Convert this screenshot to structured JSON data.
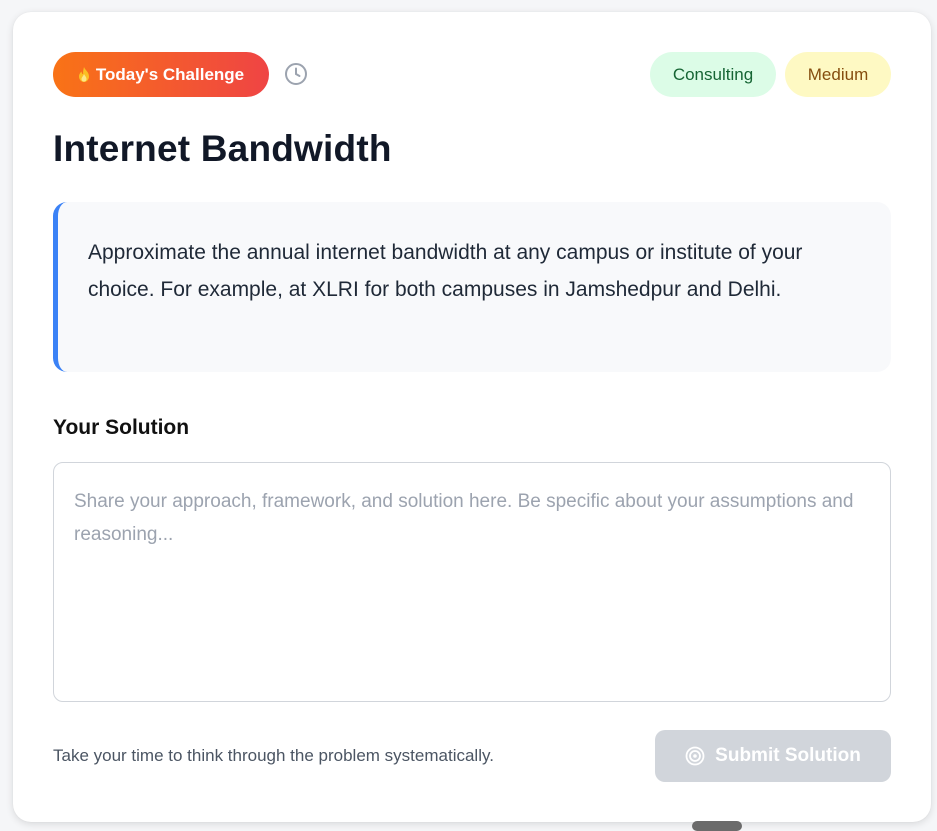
{
  "header": {
    "challenge_badge_label": "Today's Challenge",
    "category_tag": "Consulting",
    "difficulty_tag": "Medium"
  },
  "problem": {
    "title": "Internet Bandwidth",
    "description": "Approximate the annual internet bandwidth at any campus or institute of your choice. For example, at XLRI for both campuses in Jamshedpur and Delhi."
  },
  "solution": {
    "label": "Your Solution",
    "placeholder": "Share your approach, framework, and solution here. Be specific about your assumptions and reasoning...",
    "value": ""
  },
  "footer": {
    "hint": "Take your time to think through the problem systematically.",
    "submit_label": "Submit Solution"
  },
  "icons": {
    "badge": "fire-icon",
    "timer": "clock-icon",
    "submit": "target-icon"
  },
  "colors": {
    "badge_gradient_start": "#f97316",
    "badge_gradient_end": "#ef4444",
    "accent_border": "#3b82f6",
    "consulting_bg": "#dcfce7",
    "consulting_text": "#166534",
    "medium_bg": "#fef9c3",
    "medium_text": "#854d0e",
    "submit_disabled_bg": "#d1d5db"
  }
}
